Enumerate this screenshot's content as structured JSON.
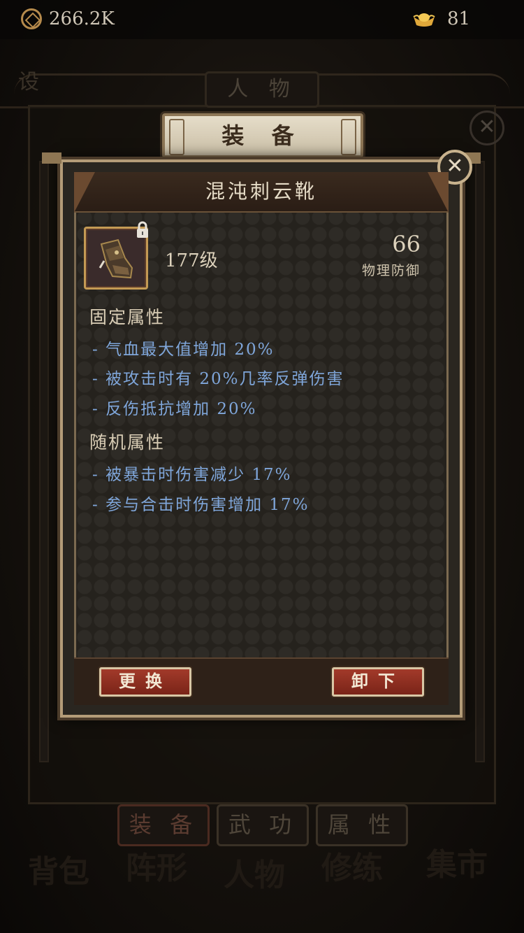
{
  "status_bar": {
    "coins": "266.2K",
    "ingots": "81"
  },
  "background": {
    "top_tab": "人 物",
    "side_left_char": "设",
    "tabs": [
      "装 备",
      "武 功",
      "属 性"
    ],
    "bottom_nav": [
      "背包",
      "阵形",
      "人物",
      "修练",
      "集市"
    ]
  },
  "header_tab": "装 备",
  "item": {
    "name": "混沌刺云靴",
    "level": "177级",
    "main_stat_value": "66",
    "main_stat_label": "物理防御"
  },
  "fixed_attributes": {
    "title": "固定属性",
    "lines": [
      "- 气血最大值增加 20%",
      "- 被攻击时有 20%几率反弹伤害",
      "- 反伤抵抗增加 20%"
    ]
  },
  "random_attributes": {
    "title": "随机属性",
    "lines": [
      "- 被暴击时伤害减少 17%",
      "- 参与合击时伤害增加 17%"
    ]
  },
  "buttons": {
    "replace": "更换",
    "unequip": "卸下"
  },
  "colors": {
    "attribute_text": "#7fa6da",
    "button_red": "#a23a2a",
    "frame_gold": "#b49c78"
  }
}
